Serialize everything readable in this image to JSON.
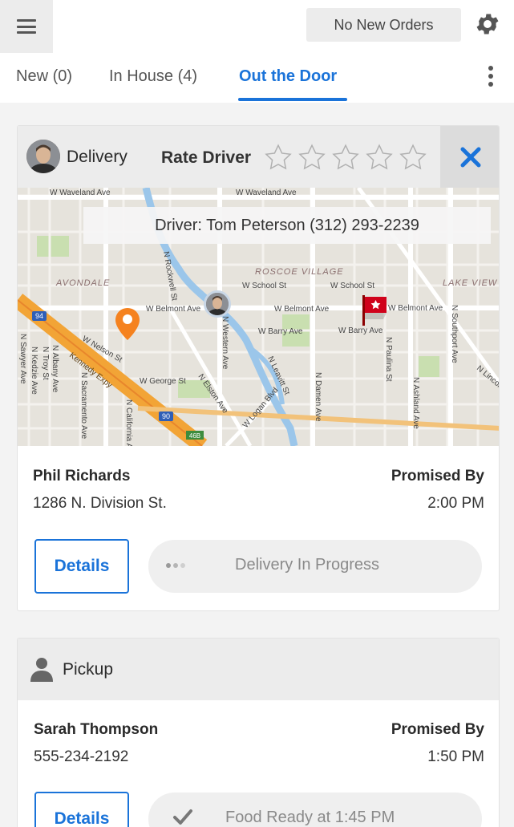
{
  "topbar": {
    "menu_icon": "hamburger-icon",
    "orders_status": "No New Orders",
    "settings_icon": "gear-icon"
  },
  "tabs": [
    {
      "label": "New (0)",
      "active": false
    },
    {
      "label": "In House (4)",
      "active": false
    },
    {
      "label": "Out the Door",
      "active": true
    }
  ],
  "more_icon": "vertical-ellipsis-icon",
  "colors": {
    "accent": "#1a73d9",
    "header_gray": "#ececec",
    "pin_orange": "#f5821f",
    "flag_red": "#d0021b"
  },
  "delivery_card": {
    "type_label": "Delivery",
    "rate_label": "Rate Driver",
    "rating": 0,
    "rating_max": 5,
    "close_icon": "close-icon",
    "driver_banner": "Driver: Tom Peterson (312) 293-2239",
    "map_labels": {
      "waveland": "W Waveland Ave",
      "roscoe": "ROSCOE VILLAGE",
      "avondale": "AVONDALE",
      "lakeview": "LAKE VIEW",
      "school_st_1": "W School St",
      "school_st_2": "W School St",
      "belmont_1": "W Belmont Ave",
      "belmont_2": "W Belmont Ave",
      "belmont_3": "W Belmont Ave",
      "barry_1": "W Barry Ave",
      "barry_2": "W Barry Ave",
      "nelson": "W Nelson St",
      "george": "W George St",
      "kennedy": "Kennedy Expy",
      "western": "N Western Ave",
      "damen": "N Damen Ave",
      "ashland": "N Ashland Ave",
      "paulina": "N Paulina St",
      "southport": "N Southport Ave",
      "elston": "N Elston Ave",
      "logan": "W Logan Blvd",
      "leavitt": "N Leavitt St",
      "sacramento": "N Sacramento Ave",
      "california": "N California Ave",
      "albany": "N Albany Ave",
      "troy": "N Troy St",
      "kedzie": "N Kedzie Ave",
      "sawyer": "N Sawyer Ave",
      "lincoln": "N Lincoln Ave",
      "rockwell": "N Rockwell St",
      "shield_94": "94",
      "shield_90": "90",
      "exit_46b": "46B"
    },
    "customer_name": "Phil Richards",
    "customer_address": "1286 N. Division St.",
    "promised_label": "Promised By",
    "promised_time": "2:00 PM",
    "details_label": "Details",
    "status": "Delivery In Progress"
  },
  "pickup_card": {
    "type_label": "Pickup",
    "customer_name": "Sarah Thompson",
    "customer_phone": "555-234-2192",
    "promised_label": "Promised By",
    "promised_time": "1:50 PM",
    "details_label": "Details",
    "status": "Food Ready at 1:45 PM",
    "status_icon": "checkmark-icon"
  }
}
